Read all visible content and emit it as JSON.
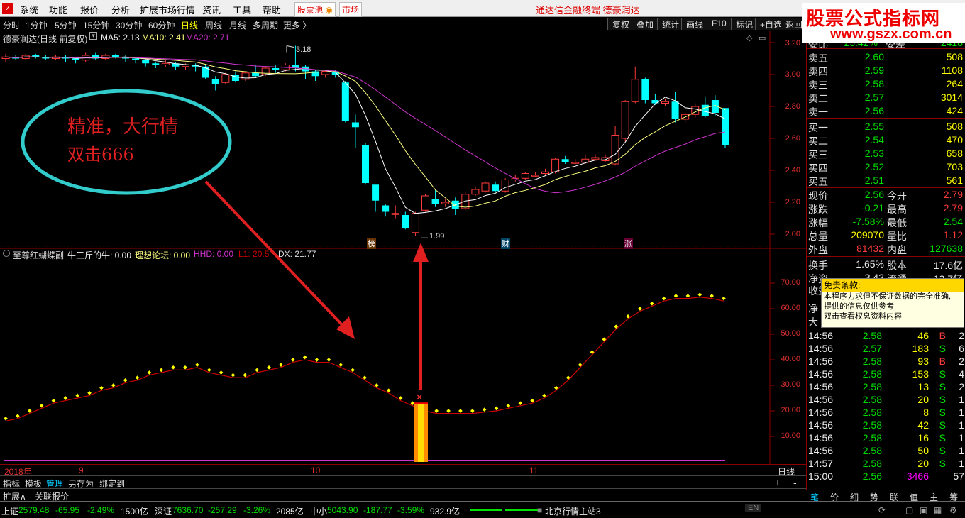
{
  "menubar": {
    "items": [
      "系统",
      "功能",
      "报价",
      "分析",
      "扩展市场行情",
      "资讯",
      "工具",
      "帮助"
    ],
    "tag_pool": "股票池",
    "tag_market": "市场",
    "title": "通达信金融终端  德豪润达"
  },
  "toolbar": {
    "periods": [
      "分时",
      "1分钟",
      "5分钟",
      "15分钟",
      "30分钟",
      "60分钟",
      "日线",
      "周线",
      "月线",
      "多周期",
      "更多 〉"
    ],
    "active_period": "日线",
    "right_buttons": [
      "复权",
      "叠加",
      "统计",
      "画线",
      "F10",
      "标记",
      "+自选",
      "返回"
    ]
  },
  "main_chart": {
    "stock_label": "德豪润达(日线 前复权)",
    "ma5": "MA5: 2.13",
    "ma10": "MA10: 2.41",
    "ma20": "MA20: 2.71",
    "price_axis": [
      "3.20",
      "3.00",
      "2.80",
      "2.60",
      "2.40",
      "2.20",
      "2.00"
    ],
    "high_mark": "3.18",
    "low_mark": "1.99",
    "markers": [
      "榜",
      "财",
      "涨"
    ]
  },
  "annotation": {
    "line1": "精准，大行情",
    "line2": "双击666"
  },
  "indicator": {
    "name": "至尊红蝴蝶副",
    "v1": "牛三斤的牛: 0.00",
    "v2": "理想论坛: 0.00",
    "v3": "HHD: 0.00",
    "v4": "L1: 20.5",
    "v5": "DX: 21.77",
    "axis": [
      "70.00",
      "60.00",
      "50.00",
      "40.00",
      "30.00",
      "20.00",
      "10.00"
    ]
  },
  "time_axis": {
    "year": "2018年",
    "months": [
      "9",
      "10",
      "11"
    ],
    "period": "日线"
  },
  "bottom_tabs": [
    "指标",
    "模板",
    "管理",
    "另存为",
    "绑定到"
  ],
  "bottom_active": "管理",
  "extbar": {
    "expand": "扩展∧",
    "linked": "关联报价"
  },
  "quote_panel": {
    "top_partial": {
      "label": "委比",
      "value": "25.42%",
      "label2": "委差",
      "value2": "2418"
    },
    "sells": [
      {
        "label": "卖五",
        "price": "2.60",
        "vol": "508"
      },
      {
        "label": "卖四",
        "price": "2.59",
        "vol": "1108"
      },
      {
        "label": "卖三",
        "price": "2.58",
        "vol": "264"
      },
      {
        "label": "卖二",
        "price": "2.57",
        "vol": "3014"
      },
      {
        "label": "卖一",
        "price": "2.56",
        "vol": "424"
      }
    ],
    "buys": [
      {
        "label": "买一",
        "price": "2.55",
        "vol": "508"
      },
      {
        "label": "买二",
        "price": "2.54",
        "vol": "470"
      },
      {
        "label": "买三",
        "price": "2.53",
        "vol": "658"
      },
      {
        "label": "买四",
        "price": "2.52",
        "vol": "703"
      },
      {
        "label": "买五",
        "price": "2.51",
        "vol": "561"
      }
    ],
    "stats": [
      {
        "l1": "现价",
        "v1": "2.56",
        "c1": "dn",
        "l2": "今开",
        "v2": "2.79",
        "c2": "up"
      },
      {
        "l1": "涨跌",
        "v1": "-0.21",
        "c1": "dn",
        "l2": "最高",
        "v2": "2.79",
        "c2": "up"
      },
      {
        "l1": "涨幅",
        "v1": "-7.58%",
        "c1": "dn",
        "l2": "最低",
        "v2": "2.54",
        "c2": "dn"
      },
      {
        "l1": "总量",
        "v1": "209070",
        "c1": "ye",
        "l2": "量比",
        "v2": "1.12",
        "c2": "up"
      },
      {
        "l1": "外盘",
        "v1": "81432",
        "c1": "up",
        "l2": "内盘",
        "v2": "127638",
        "c2": "dn"
      }
    ],
    "stats2": [
      {
        "l1": "换手",
        "v1": "1.65%",
        "l2": "股本",
        "v2": "17.6亿"
      },
      {
        "l1": "净资",
        "v1": "3.43",
        "l2": "流通",
        "v2": "12.7亿"
      }
    ],
    "hidden_labels": [
      "收益",
      "净",
      "大"
    ],
    "ticks": [
      {
        "time": "14:56",
        "price": "2.58",
        "vol": "46",
        "bs": "B",
        "n": "2"
      },
      {
        "time": "14:56",
        "price": "2.57",
        "vol": "183",
        "bs": "S",
        "n": "6"
      },
      {
        "time": "14:56",
        "price": "2.58",
        "vol": "93",
        "bs": "B",
        "n": "2"
      },
      {
        "time": "14:56",
        "price": "2.58",
        "vol": "153",
        "bs": "S",
        "n": "4"
      },
      {
        "time": "14:56",
        "price": "2.58",
        "vol": "13",
        "bs": "S",
        "n": "2"
      },
      {
        "time": "14:56",
        "price": "2.58",
        "vol": "20",
        "bs": "S",
        "n": "1"
      },
      {
        "time": "14:56",
        "price": "2.58",
        "vol": "8",
        "bs": "S",
        "n": "1"
      },
      {
        "time": "14:56",
        "price": "2.58",
        "vol": "42",
        "bs": "S",
        "n": "1"
      },
      {
        "time": "14:56",
        "price": "2.58",
        "vol": "16",
        "bs": "S",
        "n": "1"
      },
      {
        "time": "14:56",
        "price": "2.58",
        "vol": "50",
        "bs": "S",
        "n": "1"
      },
      {
        "time": "14:57",
        "price": "2.58",
        "vol": "20",
        "bs": "S",
        "n": "1"
      },
      {
        "time": "15:00",
        "price": "2.56",
        "vol": "3466",
        "bs": "",
        "n": "57"
      }
    ],
    "bottom_tabs": [
      "笔",
      "价",
      "细",
      "势",
      "联",
      "值",
      "主",
      "筹"
    ]
  },
  "tooltip": {
    "title": "免责条款:",
    "lines": [
      "本程序力求但不保证数据的完全准确,",
      "提供的信息仅供参考",
      "双击查看权息资料内容"
    ]
  },
  "watermark": {
    "line1": "股票公式指标网",
    "line2": "www.gszx.com.cn"
  },
  "statusbar": {
    "sh_label": "上证",
    "sh_val": "2579.48",
    "sh_chg": "-65.95",
    "sh_pct": "-2.49%",
    "sh_amt": "1500亿",
    "sz_label": "深证",
    "sz_val": "7636.70",
    "sz_chg": "-257.29",
    "sz_pct": "-3.26%",
    "sz_amt": "2085亿",
    "zx_label": "中小",
    "zx_val": "5043.90",
    "zx_chg": "-187.77",
    "zx_pct": "-3.59%",
    "zx_amt": "932.9亿",
    "server": "北京行情主站3",
    "ime": "EN"
  },
  "colors": {
    "up": "#ff3b3b",
    "down": "#00ffff",
    "ma5": "#ffffff",
    "ma10": "#ffff80",
    "ma20": "#cc33cc",
    "dots": "#ffff00",
    "curve": "#cc0000"
  }
}
